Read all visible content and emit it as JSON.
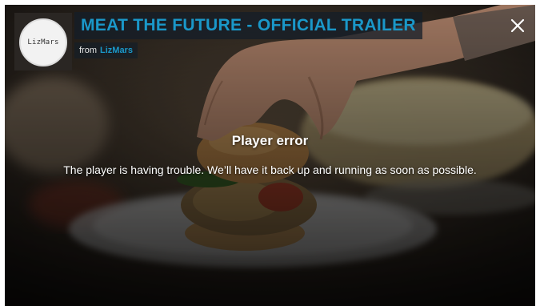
{
  "header": {
    "channel_logo_text": "LizMars",
    "title": "MEAT THE FUTURE - OFFICIAL TRAILER",
    "byline_prefix": "from",
    "author": "LizMars",
    "close_icon": "close-icon"
  },
  "error": {
    "title": "Player error",
    "message": "The player is having trouble. We’ll have it back up and running as soon as possible."
  },
  "colors": {
    "accent": "#1a98c9",
    "overlay_text": "#ffffff"
  }
}
